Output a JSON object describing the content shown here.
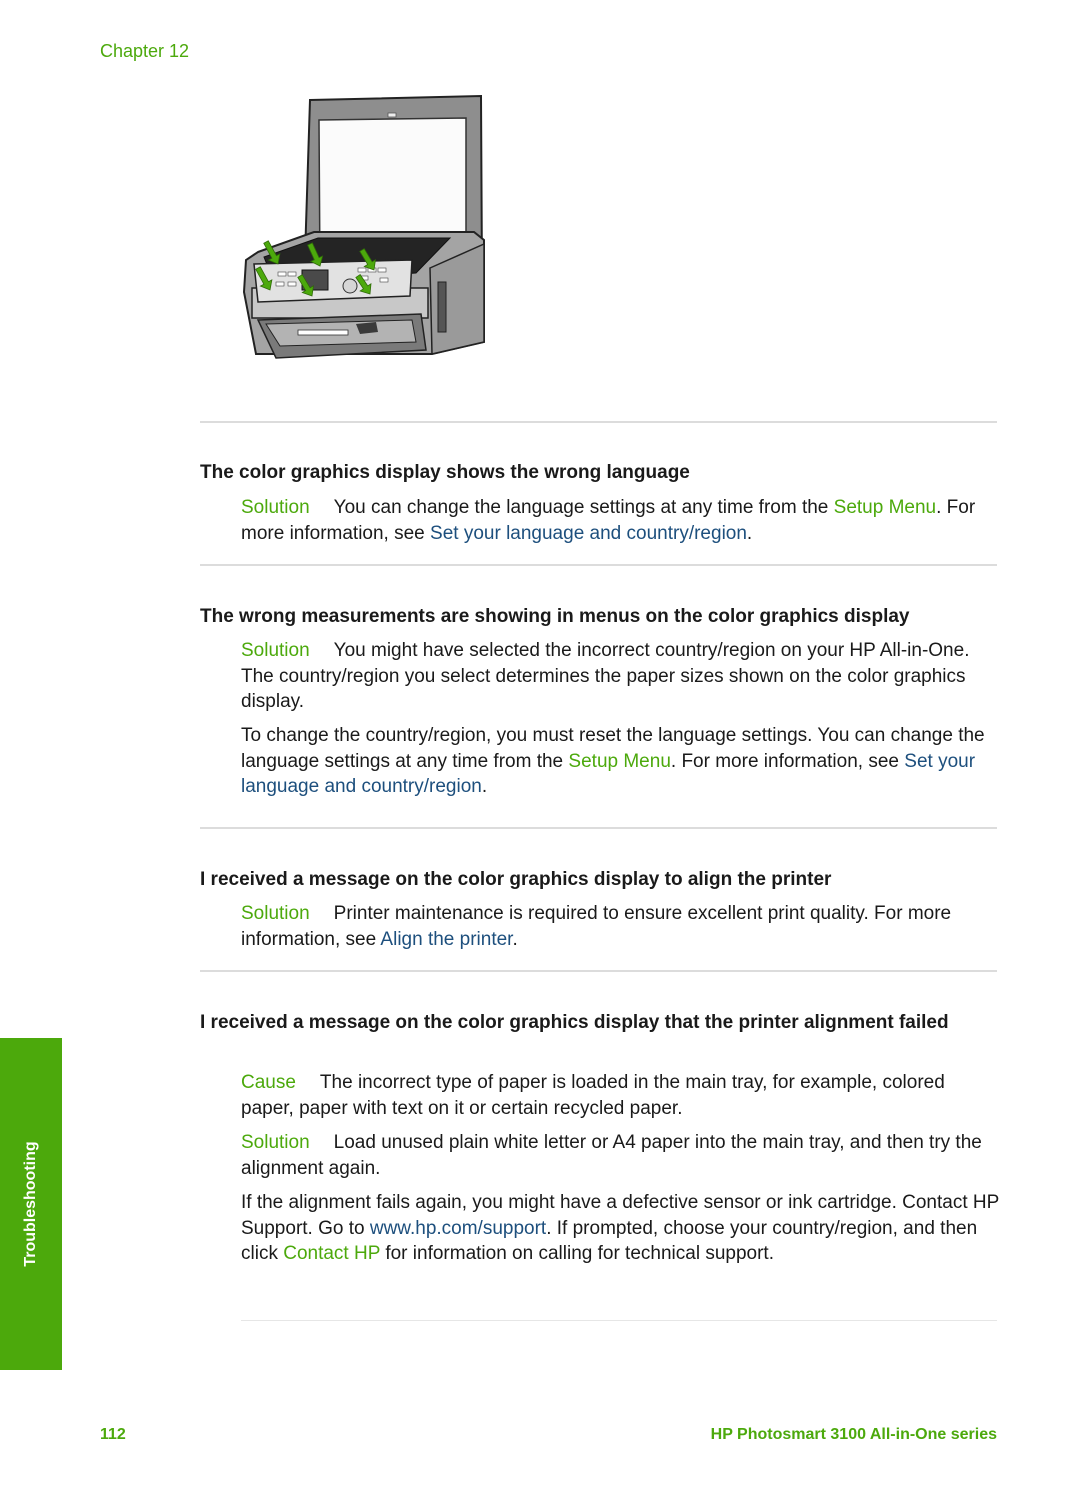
{
  "header": {
    "chapter_label": "Chapter 12"
  },
  "figure": {
    "description": "HP All-in-One printer with lid open, green arrows pointing at control panel overlay",
    "arrow_color": "#4ca90c",
    "arrow_count": 6
  },
  "sections": [
    {
      "heading": "The color graphics display shows the wrong language",
      "paragraphs": [
        {
          "label": "Solution",
          "parts": [
            {
              "text": "You can change the language settings at any time from the ",
              "style": "plain"
            },
            {
              "text": "Setup Menu",
              "style": "ui-term"
            },
            {
              "text": ". For more information, see ",
              "style": "plain"
            },
            {
              "text": "Set your language and country/region",
              "style": "link"
            },
            {
              "text": ".",
              "style": "plain"
            }
          ]
        }
      ]
    },
    {
      "heading": "The wrong measurements are showing in menus on the color graphics display",
      "paragraphs": [
        {
          "label": "Solution",
          "parts": [
            {
              "text": "You might have selected the incorrect country/region on your HP All-in-One. The country/region you select determines the paper sizes shown on the color graphics display.",
              "style": "plain"
            }
          ]
        },
        {
          "label": "",
          "parts": [
            {
              "text": "To change the country/region, you must reset the language settings. You can change the language settings at any time from the ",
              "style": "plain"
            },
            {
              "text": "Setup Menu",
              "style": "ui-term"
            },
            {
              "text": ". For more information, see ",
              "style": "plain"
            },
            {
              "text": "Set your language and country/region",
              "style": "link"
            },
            {
              "text": ".",
              "style": "plain"
            }
          ]
        }
      ]
    },
    {
      "heading": "I received a message on the color graphics display to align the printer",
      "paragraphs": [
        {
          "label": "Solution",
          "parts": [
            {
              "text": "Printer maintenance is required to ensure excellent print quality. For more information, see ",
              "style": "plain"
            },
            {
              "text": "Align the printer",
              "style": "link"
            },
            {
              "text": ".",
              "style": "plain"
            }
          ]
        }
      ]
    },
    {
      "heading": "I received a message on the color graphics display that the printer alignment failed",
      "paragraphs": [
        {
          "label": "Cause",
          "parts": [
            {
              "text": "The incorrect type of paper is loaded in the main tray, for example, colored paper, paper with text on it or certain recycled paper.",
              "style": "plain"
            }
          ]
        },
        {
          "label": "Solution",
          "parts": [
            {
              "text": "Load unused plain white letter or A4 paper into the main tray, and then try the alignment again.",
              "style": "plain"
            }
          ]
        },
        {
          "label": "",
          "parts": [
            {
              "text": "If the alignment fails again, you might have a defective sensor or ink cartridge. Contact HP Support. Go to ",
              "style": "plain"
            },
            {
              "text": "www.hp.com/support",
              "style": "link"
            },
            {
              "text": ". If prompted, choose your country/region, and then click ",
              "style": "plain"
            },
            {
              "text": "Contact HP",
              "style": "ui-term"
            },
            {
              "text": " for information on calling for technical support.",
              "style": "plain"
            }
          ]
        }
      ]
    }
  ],
  "side_tab": {
    "label": "Troubleshooting",
    "color": "#4ca90c"
  },
  "footer": {
    "page_number": "112",
    "title": "HP Photosmart 3100 All-in-One series"
  },
  "colors": {
    "accent_green": "#4ca90c",
    "link_blue": "#1d4f7d",
    "body_text": "#1a1a1a"
  }
}
